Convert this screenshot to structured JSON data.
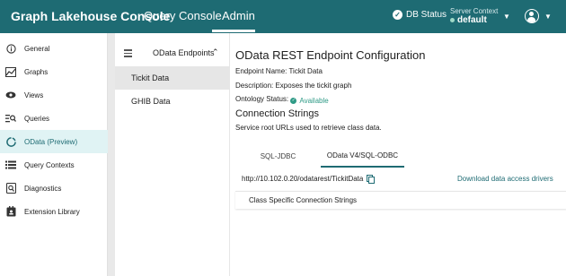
{
  "header": {
    "app_title": "Graph Lakehouse Console",
    "nav": [
      {
        "label": "Query Console"
      },
      {
        "label": "Admin"
      }
    ],
    "db_status": "DB Status",
    "server_context": {
      "label": "Server Context",
      "value": "default"
    },
    "colors": {
      "bar": "#1e6b73",
      "accent": "#1e6b73"
    }
  },
  "sidebar": {
    "items": [
      {
        "label": "General",
        "icon": "info-icon"
      },
      {
        "label": "Graphs",
        "icon": "graph-icon"
      },
      {
        "label": "Views",
        "icon": "eye-icon"
      },
      {
        "label": "Queries",
        "icon": "query-icon"
      },
      {
        "label": "OData (Preview)",
        "icon": "odata-icon",
        "active": true
      },
      {
        "label": "Query Contexts",
        "icon": "list-icon"
      },
      {
        "label": "Diagnostics",
        "icon": "diagnostics-icon"
      },
      {
        "label": "Extension Library",
        "icon": "library-icon"
      }
    ]
  },
  "endpoints": {
    "title": "OData Endpoints",
    "items": [
      {
        "label": "Tickit Data",
        "active": true
      },
      {
        "label": "GHIB Data"
      }
    ]
  },
  "main": {
    "title": "OData REST Endpoint Configuration",
    "endpoint_name": "Endpoint Name: Tickit Data",
    "description": "Description: Exposes the tickit graph",
    "ontology_label": "Ontology Status:",
    "ontology_value": "Available",
    "section_title": "Connection Strings",
    "section_desc": "Service root URLs used to retrieve class data.",
    "tabs": [
      {
        "label": "SQL-JDBC"
      },
      {
        "label": "OData V4/SQL-ODBC",
        "selected": true
      }
    ],
    "url": "http://10.102.0.20/odatarest/TickitData",
    "download_label": "Download data access drivers",
    "class_panel_label": "Class Specific Connection Strings"
  }
}
